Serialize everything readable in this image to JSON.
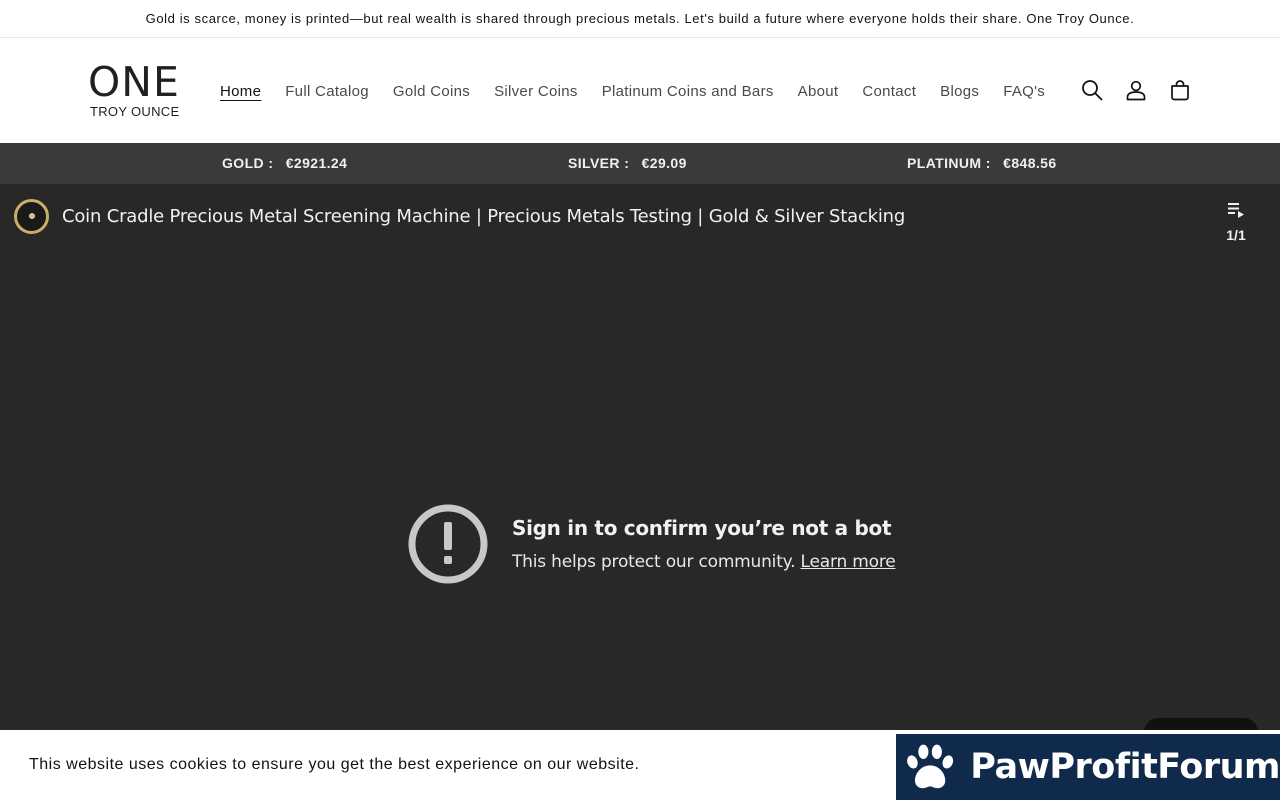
{
  "announcement": {
    "text": "Gold is scarce, money is printed—but real wealth is shared through precious metals. Let's build a future where everyone holds their share. One Troy Ounce."
  },
  "header": {
    "logo_main": "ONE",
    "logo_sub": "TROY OUNCE",
    "nav": [
      {
        "label": "Home",
        "active": true
      },
      {
        "label": "Full Catalog"
      },
      {
        "label": "Gold Coins"
      },
      {
        "label": "Silver Coins"
      },
      {
        "label": "Platinum Coins and Bars"
      },
      {
        "label": "About"
      },
      {
        "label": "Contact"
      },
      {
        "label": "Blogs"
      },
      {
        "label": "FAQ's"
      }
    ],
    "icons": [
      "search-icon",
      "account-icon",
      "cart-icon"
    ]
  },
  "ticker": {
    "gold": {
      "label": "GOLD :",
      "price": "€2921.24"
    },
    "silver": {
      "label": "SILVER :",
      "price": "€29.09"
    },
    "platinum": {
      "label": "PLATINUM :",
      "price": "€848.56"
    }
  },
  "video": {
    "title": "Coin Cradle Precious Metal Screening Machine | Precious Metals Testing | Gold & Silver Stacking",
    "playlist_count": "1/1",
    "bot_heading": "Sign in to confirm you’re not a bot",
    "bot_text": "This helps protect our community.",
    "bot_link": "Learn more"
  },
  "cookie": {
    "text": "This website uses cookies to ensure you get the best experience on our website."
  },
  "forum_badge": {
    "text": "PawProfitForum"
  },
  "colors": {
    "ticker_bg": "#3a3a3a",
    "video_bg": "#282828",
    "badge_bg": "#0f2a4a",
    "avatar_ring": "#c9b06a"
  }
}
